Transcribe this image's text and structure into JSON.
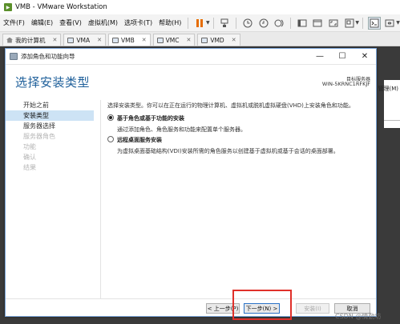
{
  "window": {
    "title": "VMB - VMware Workstation"
  },
  "menubar": {
    "items": [
      "文件(F)",
      "编辑(E)",
      "查看(V)",
      "虚拟机(M)",
      "选项卡(T)",
      "帮助(H)"
    ]
  },
  "tabs": [
    {
      "label": "我的计算机",
      "active": false
    },
    {
      "label": "VMA",
      "active": false
    },
    {
      "label": "VMB",
      "active": true
    },
    {
      "label": "VMC",
      "active": false
    },
    {
      "label": "VMD",
      "active": false
    }
  ],
  "guest": {
    "side_text": "管理(M)"
  },
  "wizard": {
    "title": "添加角色和功能向导",
    "heading": "选择安装类型",
    "target_label": "目标服务器",
    "target_server": "WIN-5KRNC1RFKJF",
    "nav": [
      {
        "label": "开始之前",
        "state": "normal"
      },
      {
        "label": "安装类型",
        "state": "active"
      },
      {
        "label": "服务器选择",
        "state": "normal"
      },
      {
        "label": "服务器角色",
        "state": "disabled"
      },
      {
        "label": "功能",
        "state": "disabled"
      },
      {
        "label": "确认",
        "state": "disabled"
      },
      {
        "label": "结果",
        "state": "disabled"
      }
    ],
    "intro": "选择安装类型。你可以在正在运行的物理计算机、虚拟机或脱机虚拟硬盘(VHD)上安装角色和功能。",
    "options": [
      {
        "title": "基于角色或基于功能的安装",
        "desc": "通过添加角色、角色服务和功能来配置单个服务器。",
        "selected": true
      },
      {
        "title": "远程桌面服务安装",
        "desc": "为虚拟桌面基础结构(VDI)安装所需的角色服务以创建基于虚拟机或基于会话的桌面部署。",
        "selected": false
      }
    ],
    "buttons": {
      "prev": "< 上一步(P)",
      "next": "下一步(N) >",
      "install": "安装(I)",
      "cancel": "取消"
    }
  },
  "watermark": "CSDN @情勤坊"
}
